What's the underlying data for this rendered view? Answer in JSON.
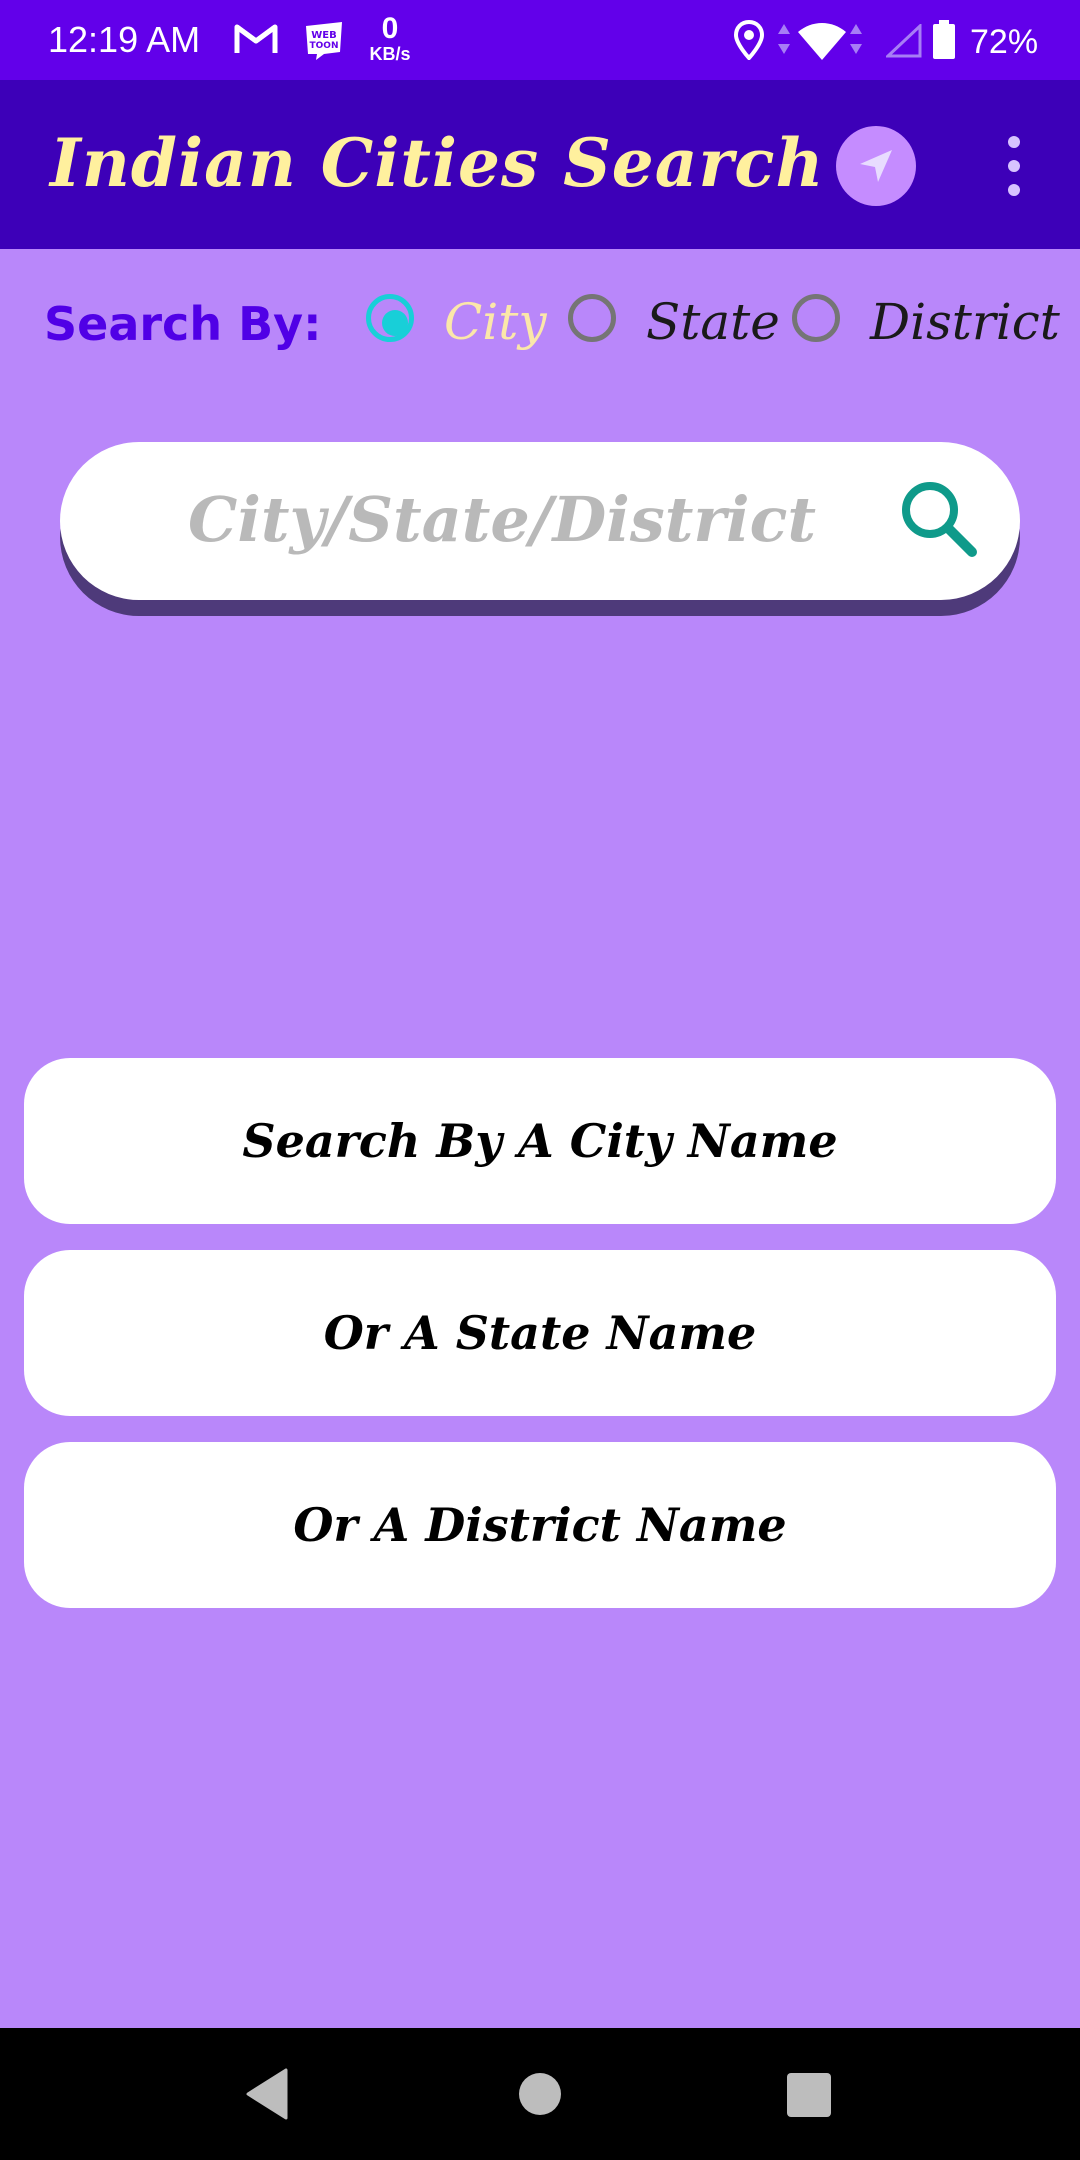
{
  "status_bar": {
    "time": "12:19 AM",
    "network_speed_value": "0",
    "network_speed_unit": "KB/s",
    "battery": "72%",
    "icons": [
      "gmail-icon",
      "webtoon-icon",
      "location-icon",
      "wifi-icon",
      "signal-icon",
      "battery-icon"
    ]
  },
  "app_bar": {
    "title": "Indian Cities Search",
    "nav_icon": "navigation-arrow-icon",
    "menu_icon": "more-vert-icon"
  },
  "search_by": {
    "label": "Search By:",
    "options": [
      {
        "label": "City",
        "checked": true
      },
      {
        "label": "State",
        "checked": false
      },
      {
        "label": "District",
        "checked": false
      }
    ]
  },
  "search": {
    "placeholder": "City/State/District",
    "value": "",
    "icon": "search-icon"
  },
  "cards": [
    {
      "label": "Search By A City Name"
    },
    {
      "label": "Or A State Name"
    },
    {
      "label": "Or A District Name"
    }
  ],
  "colors": {
    "status_bar": "#6200ea",
    "app_bar": "#3d00b8",
    "background": "#b987fa",
    "title": "#fff09e",
    "accent": "#18cfd8",
    "search_icon": "#0f9a8a"
  }
}
